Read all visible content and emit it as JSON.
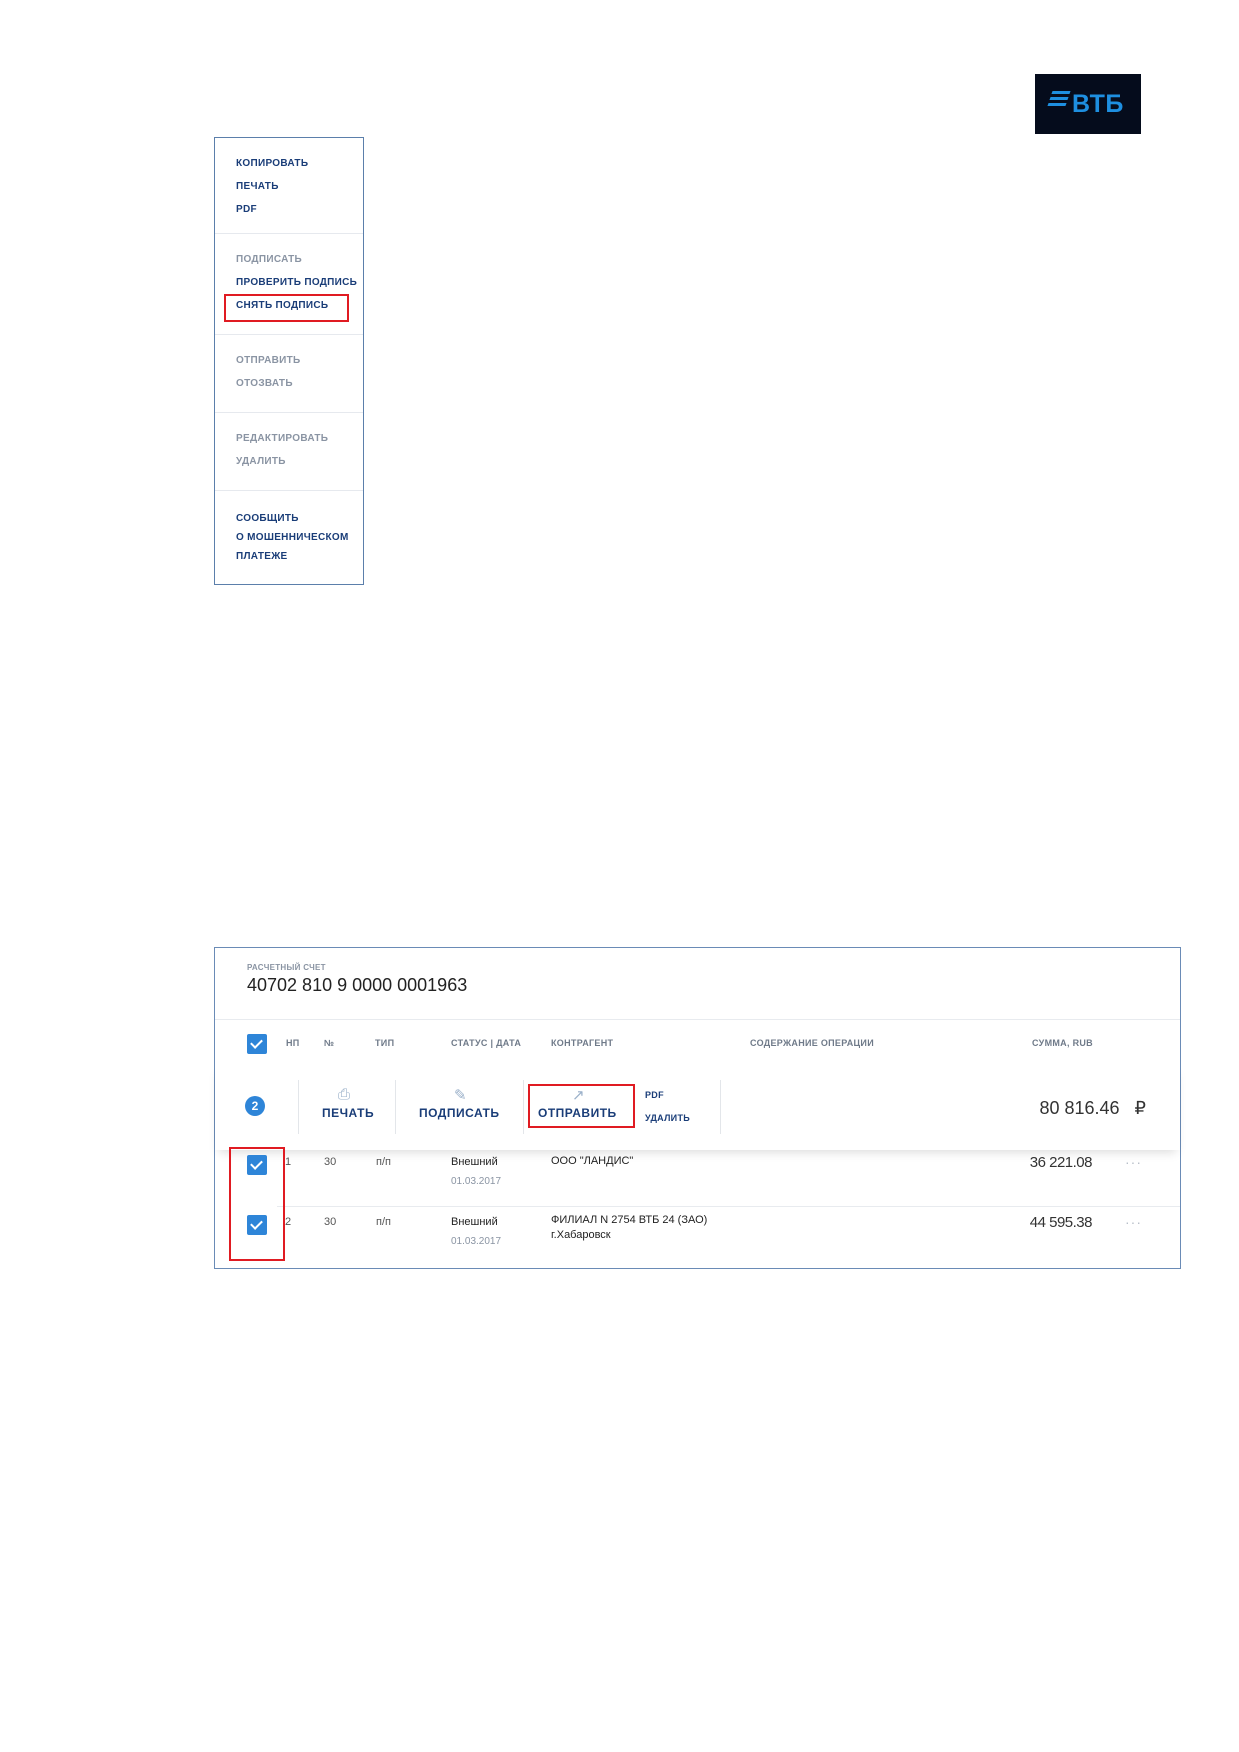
{
  "logo": {
    "text": "ВТБ"
  },
  "context_menu": {
    "groups": [
      {
        "items": [
          {
            "label": "КОПИРОВАТЬ",
            "enabled": true
          },
          {
            "label": "ПЕЧАТЬ",
            "enabled": true
          },
          {
            "label": "PDF",
            "enabled": true
          }
        ]
      },
      {
        "items": [
          {
            "label": "ПОДПИСАТЬ",
            "enabled": false
          },
          {
            "label": "ПРОВЕРИТЬ ПОДПИСЬ",
            "enabled": true
          },
          {
            "label": "СНЯТЬ ПОДПИСЬ",
            "enabled": true,
            "highlighted": true
          }
        ]
      },
      {
        "items": [
          {
            "label": "ОТПРАВИТЬ",
            "enabled": false
          },
          {
            "label": "ОТОЗВАТЬ",
            "enabled": false
          }
        ]
      },
      {
        "items": [
          {
            "label": "РЕДАКТИРОВАТЬ",
            "enabled": false
          },
          {
            "label": "УДАЛИТЬ",
            "enabled": false
          }
        ]
      },
      {
        "items": [
          {
            "label": "СООБЩИТЬ",
            "enabled": true
          },
          {
            "label": "О МОШЕННИЧЕСКОМ",
            "enabled": true
          },
          {
            "label": "ПЛАТЕЖЕ",
            "enabled": true
          }
        ]
      }
    ]
  },
  "account": {
    "label": "РАСЧЕТНЫЙ СЧЕТ",
    "number": "40702 810 9 0000 0001963"
  },
  "table": {
    "headers": {
      "np": "НП",
      "num": "№",
      "type": "ТИП",
      "status_date": "СТАТУС | ДАТА",
      "counterparty": "КОНТРАГЕНТ",
      "description": "СОДЕРЖАНИЕ ОПЕРАЦИИ",
      "amount": "СУММА, RUB"
    },
    "selected_count": "2",
    "actions": {
      "print": "ПЕЧАТЬ",
      "sign": "ПОДПИСАТЬ",
      "send": "ОТПРАВИТЬ",
      "pdf": "PDF",
      "delete": "УДАЛИТЬ"
    },
    "total": "80 816.46",
    "currency": "₽",
    "rows": [
      {
        "np": "1",
        "num": "30",
        "type": "п/п",
        "status": "Внешний",
        "date": "01.03.2017",
        "counterparty": "ООО \"ЛАНДИС\"",
        "counterparty2": "",
        "amount": "36 221.08",
        "checked": true
      },
      {
        "np": "2",
        "num": "30",
        "type": "п/п",
        "status": "Внешний",
        "date": "01.03.2017",
        "counterparty": "ФИЛИАЛ N 2754 ВТБ 24 (ЗАО)",
        "counterparty2": "г.Хабаровск",
        "amount": "44 595.38",
        "checked": true
      }
    ],
    "more": "···"
  },
  "colors": {
    "accent": "#2e85d8",
    "highlight": "#e01b22",
    "text_dark": "#1a3d78"
  }
}
